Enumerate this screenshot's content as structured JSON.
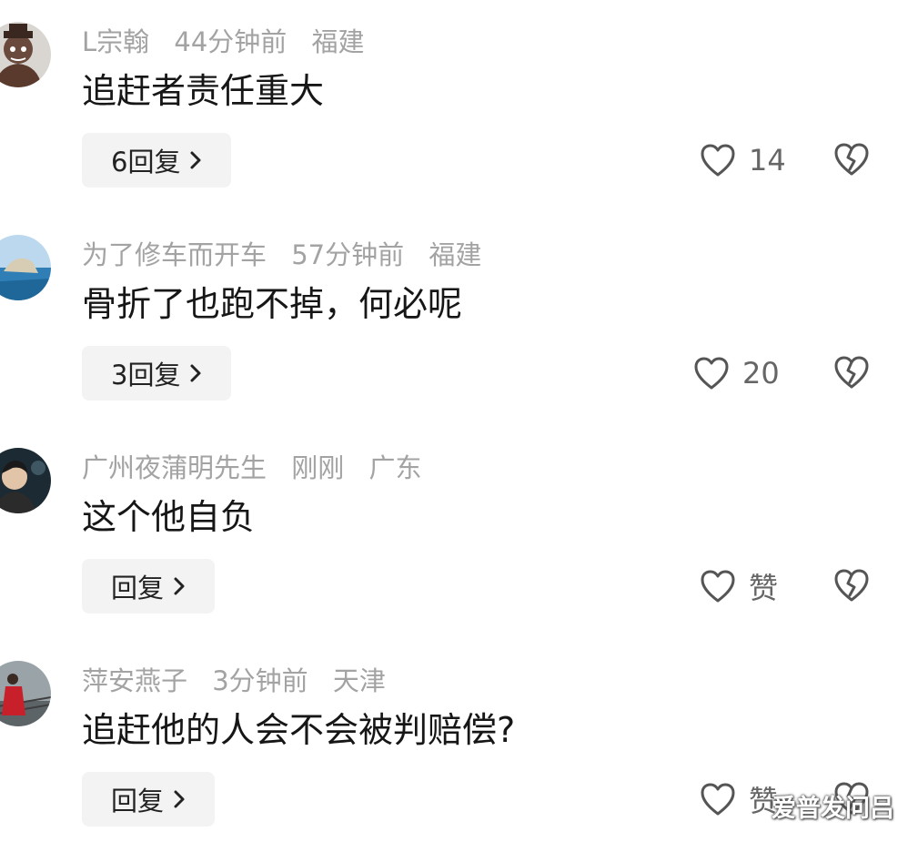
{
  "comments": [
    {
      "username": "L宗翰",
      "time": "44分钟前",
      "location": "福建",
      "text": "追赶者责任重大",
      "reply_label": "6回复",
      "like_count": "14",
      "avatar_icon": "cartoon-character-avatar"
    },
    {
      "username": "为了修车而开车",
      "time": "57分钟前",
      "location": "福建",
      "text": "骨折了也跑不掉，何必呢",
      "reply_label": "3回复",
      "like_count": "20",
      "avatar_icon": "coastal-landscape-avatar"
    },
    {
      "username": "广州夜蒲明先生",
      "time": "刚刚",
      "location": "广东",
      "text": "这个他自负",
      "reply_label": "回复",
      "like_count": "赞",
      "avatar_icon": "portrait-photo-avatar"
    },
    {
      "username": "萍安燕子",
      "time": "3分钟前",
      "location": "天津",
      "text": "追赶他的人会不会被判赔偿?",
      "reply_label": "回复",
      "like_count": "赞",
      "avatar_icon": "person-outdoor-avatar"
    }
  ],
  "watermark": "爱普发问吕",
  "icons": {
    "like": "heart-outline-icon",
    "dislike": "broken-heart-icon",
    "reply_arrow": "chevron-right-icon"
  },
  "colors": {
    "meta_text": "#a3a3a3",
    "body_text": "#161616",
    "reply_bg": "#f3f3f3",
    "icon": "#555555"
  }
}
